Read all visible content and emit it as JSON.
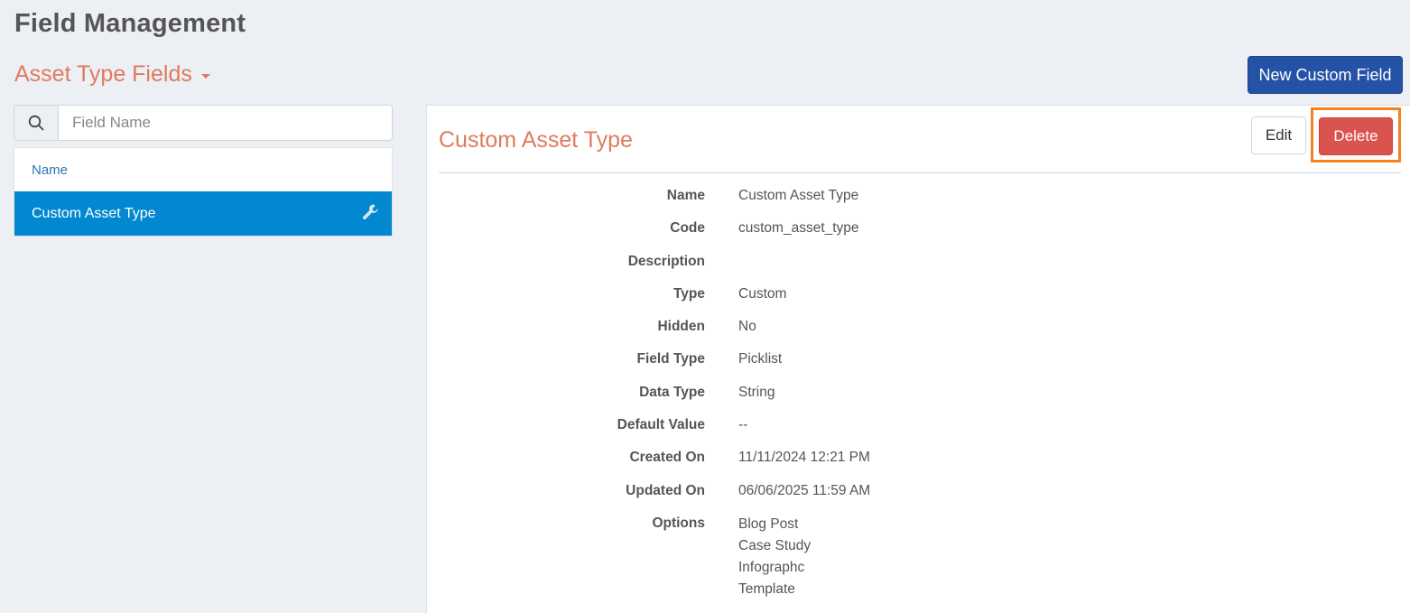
{
  "page": {
    "title": "Field Management"
  },
  "section": {
    "title": "Asset Type Fields"
  },
  "toolbar": {
    "new_field_label": "New Custom Field"
  },
  "search": {
    "placeholder": "Field Name",
    "value": ""
  },
  "list": {
    "header": "Name",
    "items": [
      {
        "label": "Custom Asset Type",
        "selected": true
      }
    ]
  },
  "detail": {
    "title": "Custom Asset Type",
    "edit_label": "Edit",
    "delete_label": "Delete",
    "rows": [
      {
        "label": "Name",
        "value": "Custom Asset Type"
      },
      {
        "label": "Code",
        "value": "custom_asset_type"
      },
      {
        "label": "Description",
        "value": ""
      },
      {
        "label": "Type",
        "value": "Custom"
      },
      {
        "label": "Hidden",
        "value": "No"
      },
      {
        "label": "Field Type",
        "value": "Picklist"
      },
      {
        "label": "Data Type",
        "value": "String"
      },
      {
        "label": "Default Value",
        "value": "--"
      },
      {
        "label": "Created On",
        "value": "11/11/2024 12:21 PM"
      },
      {
        "label": "Updated On",
        "value": "06/06/2025 11:59 AM"
      }
    ],
    "options_label": "Options",
    "options": [
      "Blog Post",
      "Case Study",
      "Infographc",
      "Template"
    ]
  },
  "colors": {
    "accent": "#e07a5f",
    "primary": "#2452a6",
    "selected": "#0288d1",
    "danger": "#d9534f",
    "highlight": "#f5821f"
  }
}
